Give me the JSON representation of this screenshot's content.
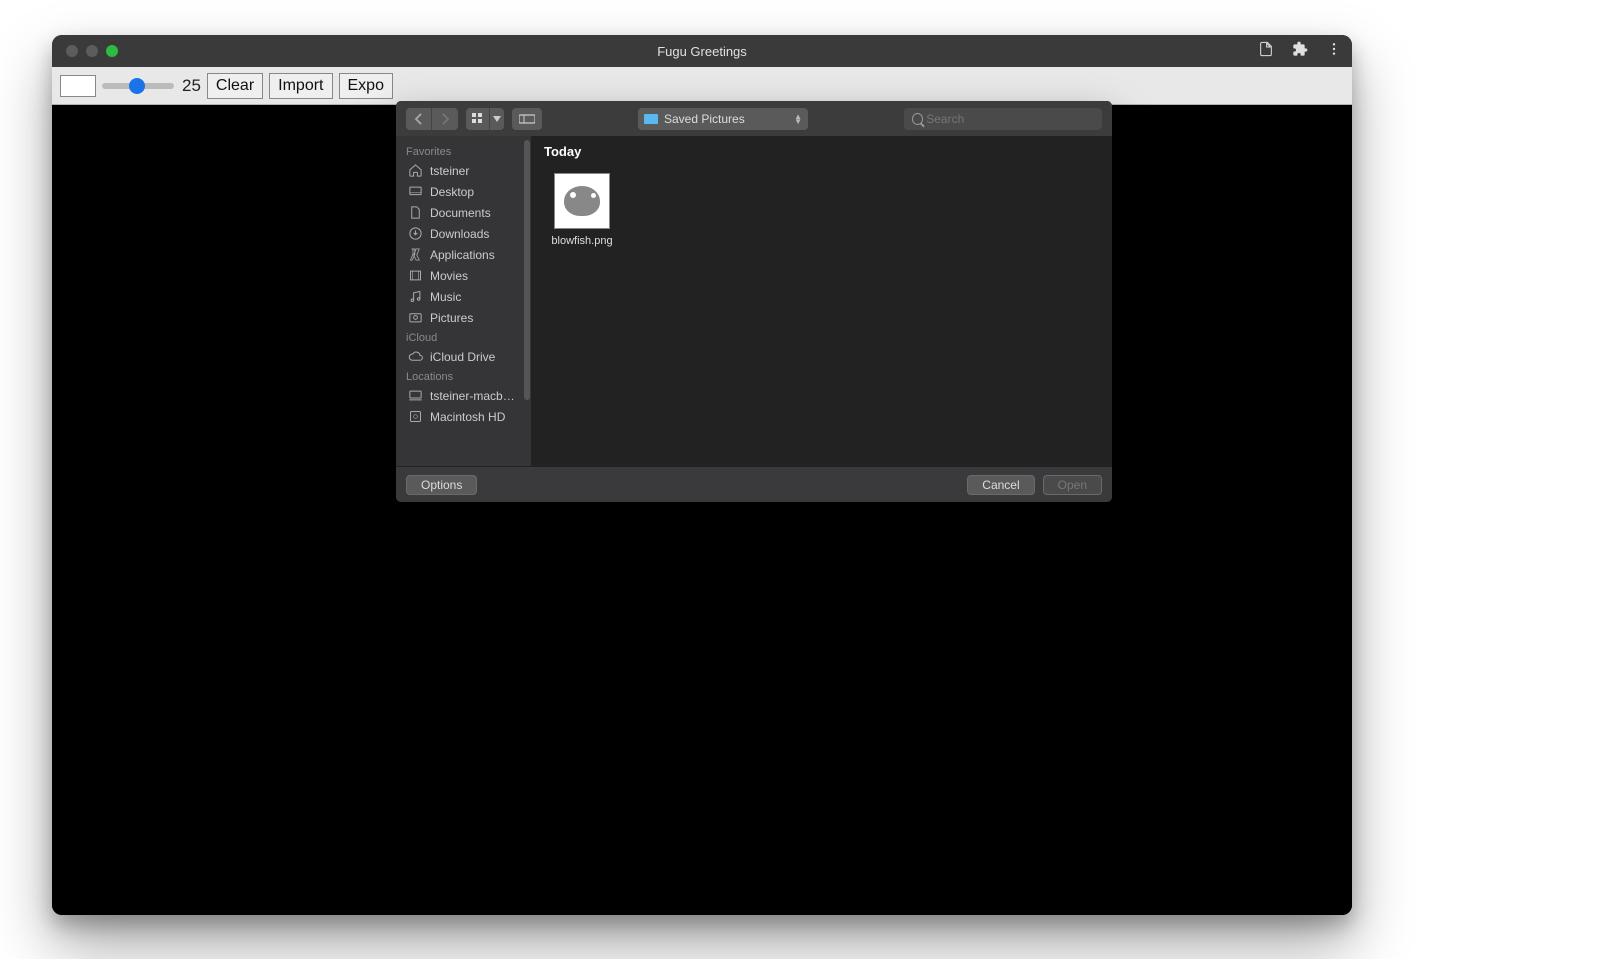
{
  "window": {
    "title": "Fugu Greetings"
  },
  "toolbar": {
    "slider_value": "25",
    "buttons": {
      "clear": "Clear",
      "import": "Import",
      "export": "Expo"
    }
  },
  "file_dialog": {
    "location": "Saved Pictures",
    "search_placeholder": "Search",
    "sidebar": {
      "favorites_label": "Favorites",
      "favorites": [
        "tsteiner",
        "Desktop",
        "Documents",
        "Downloads",
        "Applications",
        "Movies",
        "Music",
        "Pictures"
      ],
      "icloud_label": "iCloud",
      "icloud": [
        "iCloud Drive"
      ],
      "locations_label": "Locations",
      "locations": [
        "tsteiner-macb…",
        "Macintosh HD"
      ]
    },
    "content": {
      "section": "Today",
      "files": [
        {
          "name": "blowfish.png"
        }
      ]
    },
    "footer": {
      "options": "Options",
      "cancel": "Cancel",
      "open": "Open"
    }
  }
}
